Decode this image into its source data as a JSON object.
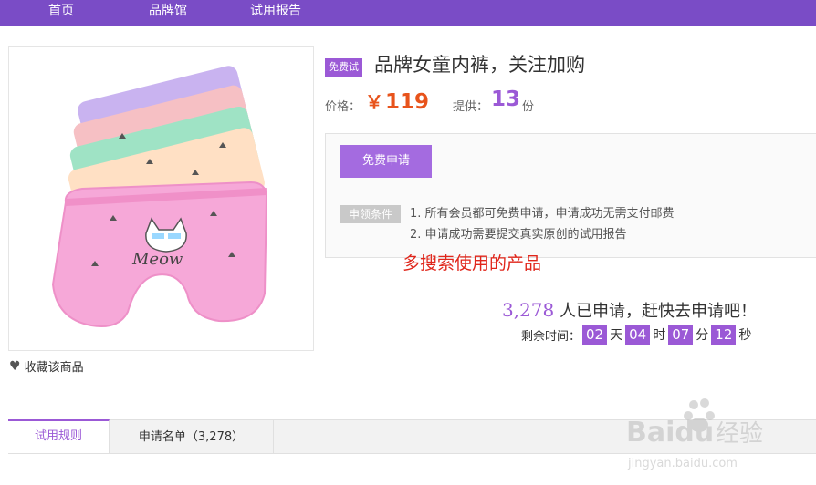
{
  "nav": {
    "items": [
      "首页",
      "品牌馆",
      "试用报告"
    ]
  },
  "product": {
    "badge": "免费试",
    "title": "品牌女童内裤，关注加购",
    "price_label": "价格：",
    "price_currency": "￥",
    "price_value": "119",
    "supply_label": "提供：",
    "supply_count": "13",
    "supply_unit": "份",
    "favorite_label": "收藏该商品",
    "image_text": "Meow"
  },
  "apply": {
    "button_label": "免费申请",
    "conditions_label": "申领条件",
    "conditions": [
      "1.  所有会员都可免费申请，申请成功无需支付邮费",
      "2.  申请成功需要提交真实原创的试用报告"
    ]
  },
  "note": "多搜索使用的产品",
  "applied": {
    "count": "3,278",
    "suffix": " 人已申请，赶快去申请吧！"
  },
  "countdown": {
    "label": "剩余时间：",
    "days": "02",
    "days_unit": "天",
    "hours": "04",
    "hours_unit": "时",
    "minutes": "07",
    "minutes_unit": "分",
    "seconds": "12",
    "seconds_unit": "秒"
  },
  "tabs": [
    {
      "label": "试用规则"
    },
    {
      "label": "申请名单（3,278）"
    }
  ],
  "watermark": {
    "brand": "Baidu",
    "brand_cn": "经验",
    "url": "jingyan.baidu.com"
  },
  "colors": {
    "nav_bg": "#7a4cc6",
    "accent": "#9b59d6",
    "price": "#e8531b",
    "note": "#e0261b"
  }
}
